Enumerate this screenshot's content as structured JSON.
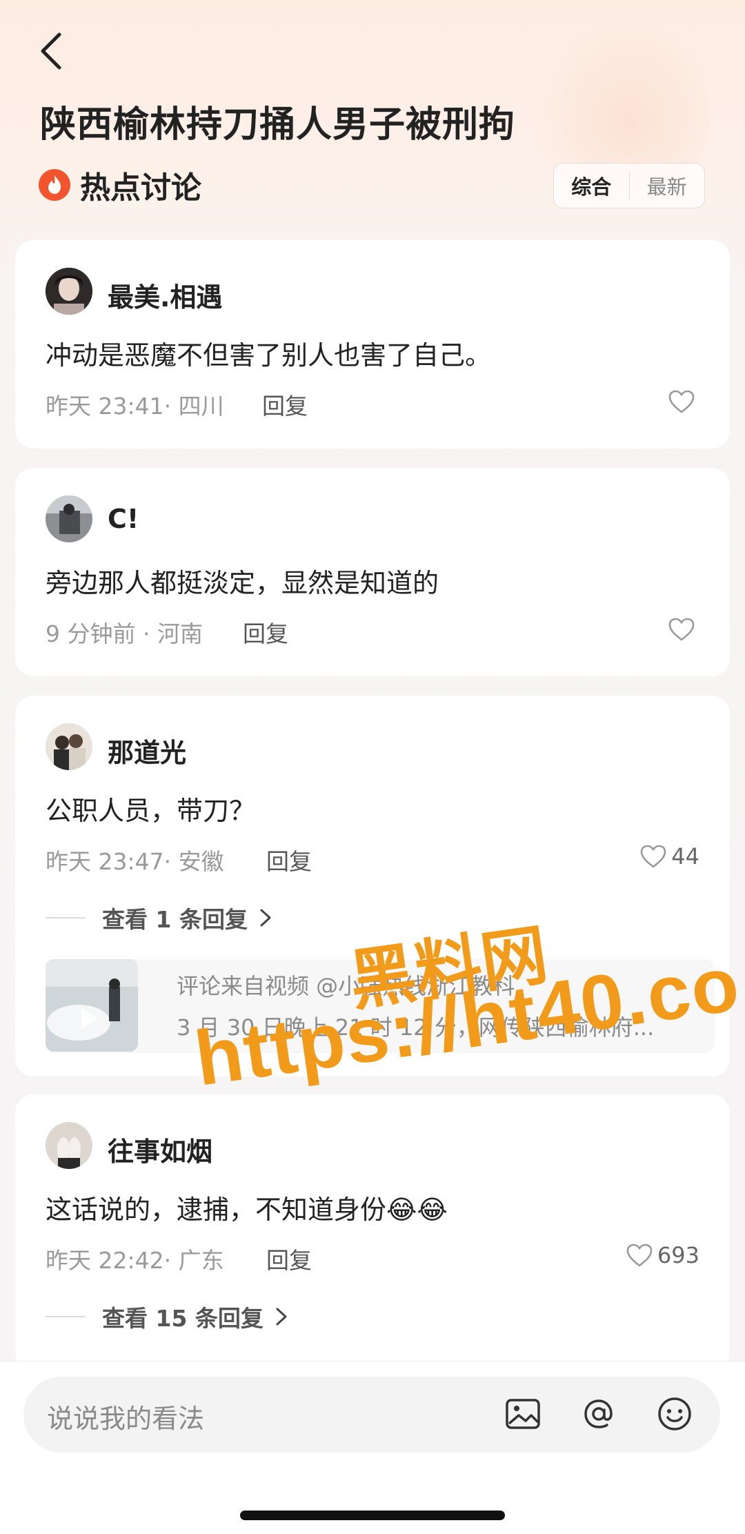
{
  "header": {
    "title": "陕西榆林持刀捅人男子被刑拘",
    "section_label": "热点讨论",
    "sort_options": [
      "综合",
      "最新"
    ],
    "active_sort": "综合"
  },
  "comments": [
    {
      "username": "最美.相遇",
      "text": "冲动是恶魔不但害了别人也害了自己。",
      "meta": "昨天 23:41· 四川",
      "reply_label": "回复",
      "likes": ""
    },
    {
      "username": "C!",
      "text": "旁边那人都挺淡定，显然是知道的",
      "meta": "9 分钟前 · 河南",
      "reply_label": "回复",
      "likes": ""
    },
    {
      "username": "那道光",
      "text": "公职人员，带刀？",
      "meta": "昨天 23:47· 安徽",
      "reply_label": "回复",
      "likes": "44",
      "view_replies": "查看 1 条回复",
      "video_ref": {
        "line1": "评论来自视频 @小强热线浙江教科",
        "line2": "3 月 30 日晚上 21 时 12 分，网传陕西榆林府..."
      }
    },
    {
      "username": "往事如烟",
      "text": "这话说的，逮捕，不知道身份😂😂",
      "meta": "昨天 22:42· 广东",
      "reply_label": "回复",
      "likes": "693",
      "view_replies": "查看 15 条回复"
    }
  ],
  "input": {
    "placeholder": "说说我的看法"
  },
  "watermark": {
    "line1": "黑料网",
    "line2": "https://ht40.co"
  },
  "colors": {
    "accent_fire": "#f2542d",
    "watermark": "#f29a1a",
    "header_bg": "#fdece2"
  }
}
